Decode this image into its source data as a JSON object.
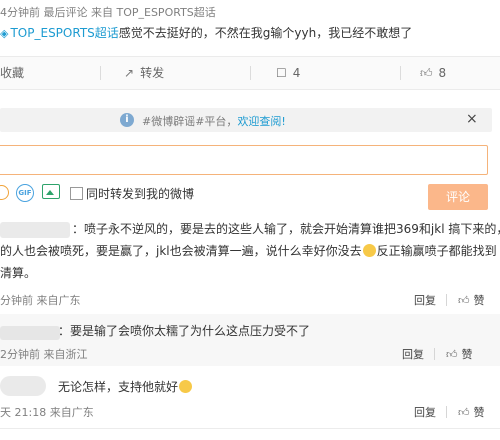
{
  "header": {
    "meta_top": "4分钟前 最后评论 来自 TOP_ESPORTS超话",
    "comment_tag": "TOP_ESPORTS超话",
    "comment_text": "感觉不去挺好的，不然在我g输个yyh，我已经不敢想了"
  },
  "actions": {
    "collect_label": "收藏",
    "forward_label": "转发",
    "comment_count": "4",
    "like_count": "8"
  },
  "notice": {
    "prefix": "#微博辟谣#平台，",
    "link": "欢迎查阅!",
    "close": "×"
  },
  "composer": {
    "placeholder": "",
    "sync_label": "同时转发到我的微博",
    "submit_label": "评论",
    "gif_label": "GIF"
  },
  "comments": [
    {
      "text_lines": [
        "：喷子永不逆风的，要是去的这些人输了，就会开始清算谁把369和jkl 搞下来的，",
        "的人也会被喷死，要是赢了，jkl也会被清算一遍，说什么幸好你没去",
        "反正输赢喷子都能找到",
        "清算。"
      ],
      "meta": "分钟前 来自广东",
      "reply": "回复",
      "like": "赞"
    },
    {
      "text": "：要是输了会喷你太糯了为什么这点压力受不了",
      "meta": "2分钟前 来自浙江",
      "reply": "回复",
      "like": "赞"
    },
    {
      "text": "无论怎样，支持他就好",
      "meta": "天 21:18 来自广东",
      "reply": "回复",
      "like": "赞"
    }
  ],
  "colors": {
    "accent_link": "#1d9bd1",
    "submit_bg": "#fbb78a",
    "input_border": "#f5b37a"
  }
}
